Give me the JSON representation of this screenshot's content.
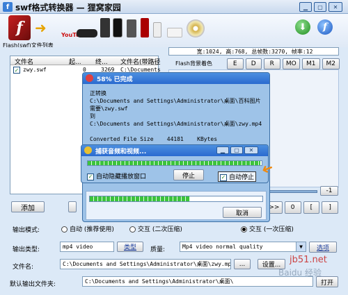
{
  "app": {
    "title": "swf格式转换器 — 狸窝家园",
    "list_label": "Flash(swf)文件列表",
    "youtube": "YouTube",
    "info_bar": "宽:1024, 高:768, 总帧数:3270, 帧率:12",
    "bg_color_label": "Flash背景着色",
    "bg_buttons": [
      "E",
      "D",
      "R",
      "MO",
      "M1",
      "M2"
    ],
    "columns": [
      "文件名",
      "起...",
      "终...",
      "文件名(带路径"
    ],
    "rows": [
      {
        "checked": "✓",
        "name": "zwy.swf",
        "start": "0",
        "end": "3269",
        "path": "C:\\Documents"
      }
    ],
    "add_button": "添加",
    "minus_one": "-1",
    "play_controls": [
      ">>",
      "0",
      "[",
      "]"
    ],
    "output_mode_label": "输出模式:",
    "modes": [
      "自动 (推荐使用)",
      "交互 (二次压缩)",
      "交互 (一次压缩)"
    ],
    "output_type_label": "输出类型:",
    "output_type_value": "mp4 video",
    "type_button": "类型",
    "quality_label": "质量:",
    "quality_value": "Mp4 video normal quality",
    "options_button": "选项",
    "filename_label": "文件名:",
    "filename_value": "C:\\Documents and Settings\\Administrator\\桌面\\zwy.mp4",
    "browse_button": "...",
    "settings_button": "设置...",
    "default_folder_label": "默认输出文件夹:",
    "default_folder_value": "C:\\Documents and Settings\\Administrator\\桌面\\",
    "open_button": "打开",
    "watermark_1": "jb51.net",
    "watermark_2": "Baidu 经验"
  },
  "progress_dialog": {
    "title": "58% 已完成",
    "log": "正转换\nC:\\Documents and Settings\\Administrator\\桌面\\百科图片\n需要\\zwy.swf\n到\nC:\\Documents and Settings\\Administrator\\桌面\\zwy.mp4\n\nConverted File Size    44181    KBytes",
    "progress": 0.58,
    "cancel": "取消"
  },
  "capture_dialog": {
    "title": "捕获音频和视频...",
    "progress": 0.99,
    "auto_hide": "自动隐藏播放窗口",
    "stop": "停止",
    "auto_stop": "自动停止",
    "check": "✓"
  }
}
